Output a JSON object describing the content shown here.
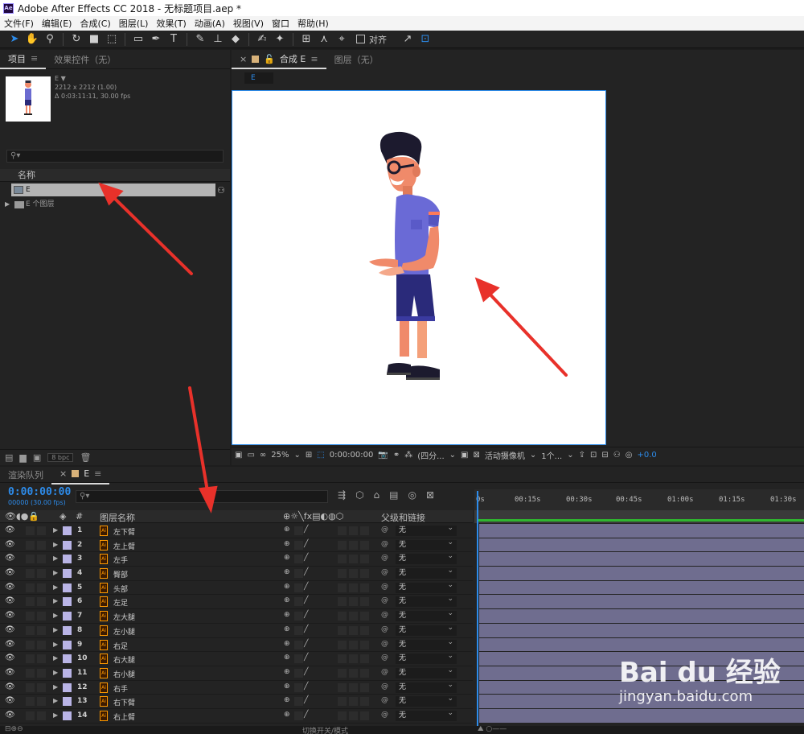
{
  "window": {
    "title": "Adobe After Effects CC 2018 - 无标题项目.aep *",
    "app_icon": "Ae"
  },
  "menu": [
    "文件(F)",
    "编辑(E)",
    "合成(C)",
    "图层(L)",
    "效果(T)",
    "动画(A)",
    "视图(V)",
    "窗口",
    "帮助(H)"
  ],
  "toolbar": {
    "snap_label": "对齐"
  },
  "project": {
    "tabs": [
      "项目",
      "效果控件（无）"
    ],
    "thumb": {
      "name": "E ▼",
      "size": "2212 x 2212 (1.00)",
      "duration": "Δ 0:03:11:11, 30.00 fps"
    },
    "column_name": "名称",
    "items": [
      {
        "name": "E"
      },
      {
        "name": "E 个图层"
      }
    ],
    "bpc": "8 bpc"
  },
  "comp": {
    "tabs": [
      "合成 E",
      "图层（无）"
    ],
    "sub_tab": "E",
    "footer": {
      "zoom": "25%",
      "timecode": "0:00:00:00",
      "resolution": "(四分...",
      "camera": "活动摄像机",
      "views": "1个...",
      "exposure": "+0.0"
    }
  },
  "timeline": {
    "tabs": [
      "渲染队列",
      "E"
    ],
    "timecode": "0:00:00:00",
    "timecode_sub": "00000 (30.00 fps)",
    "columns": {
      "num": "#",
      "name": "图层名称",
      "parent": "父级和链接"
    },
    "ruler": [
      "0s",
      "00:15s",
      "00:30s",
      "00:45s",
      "01:00s",
      "01:15s",
      "01:30s"
    ],
    "layers": [
      {
        "num": "1",
        "name": "左下臂",
        "parent": "无"
      },
      {
        "num": "2",
        "name": "左上臂",
        "parent": "无"
      },
      {
        "num": "3",
        "name": "左手",
        "parent": "无"
      },
      {
        "num": "4",
        "name": "臀部",
        "parent": "无"
      },
      {
        "num": "5",
        "name": "头部",
        "parent": "无"
      },
      {
        "num": "6",
        "name": "左足",
        "parent": "无"
      },
      {
        "num": "7",
        "name": "左大腿",
        "parent": "无"
      },
      {
        "num": "8",
        "name": "左小腿",
        "parent": "无"
      },
      {
        "num": "9",
        "name": "右足",
        "parent": "无"
      },
      {
        "num": "10",
        "name": "右大腿",
        "parent": "无"
      },
      {
        "num": "11",
        "name": "右小腿",
        "parent": "无"
      },
      {
        "num": "12",
        "name": "右手",
        "parent": "无"
      },
      {
        "num": "13",
        "name": "右下臂",
        "parent": "无"
      },
      {
        "num": "14",
        "name": "右上臂",
        "parent": "无"
      }
    ],
    "footer_mode": "切换开关/模式"
  },
  "watermark": {
    "logo": "Bai du 经验",
    "url": "jingyan.baidu.com"
  },
  "colors": {
    "accent": "#2d8ceb",
    "annotation": "#e8312a",
    "layer_bar": "#6f6d8f",
    "label": "#b9b4e6"
  }
}
